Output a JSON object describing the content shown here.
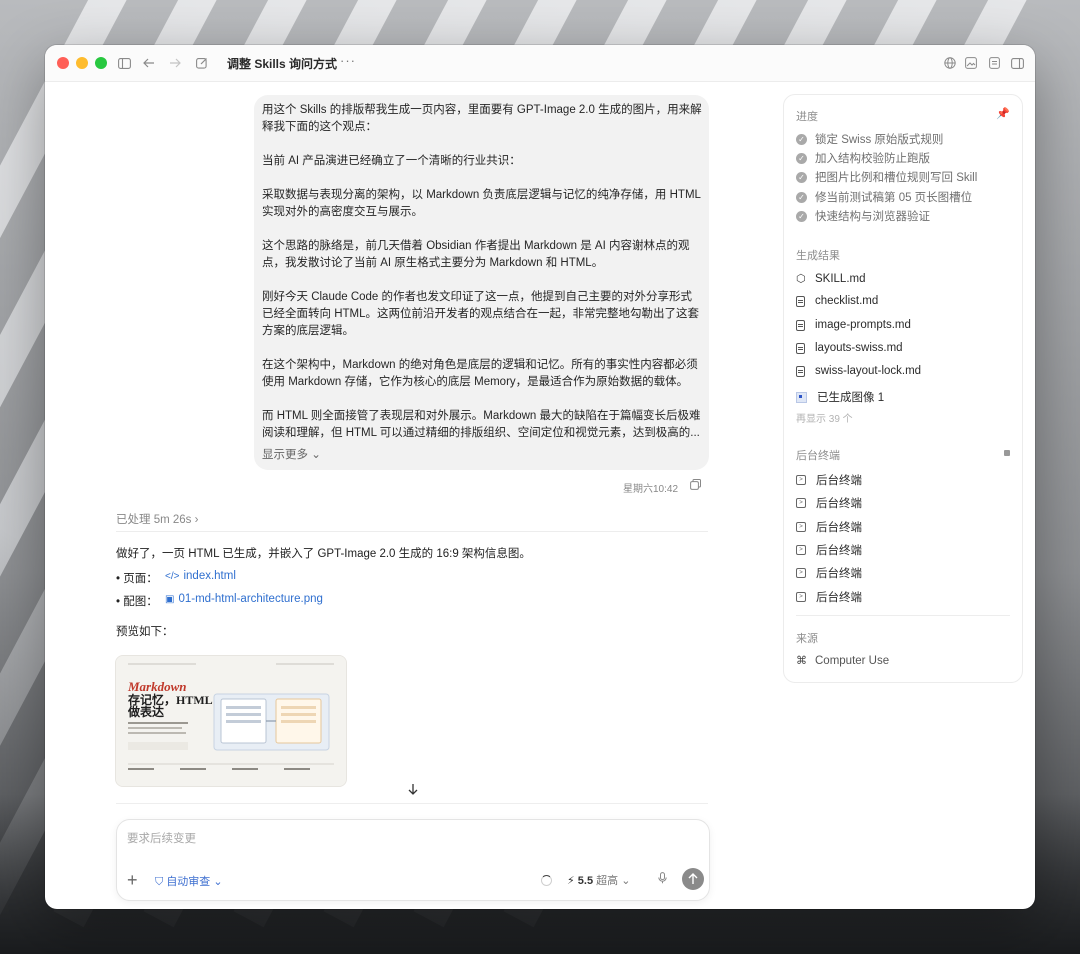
{
  "window": {
    "title": "调整 Skills 询问方式",
    "more": "···"
  },
  "user_message": {
    "paragraphs": [
      "用这个 Skills 的排版帮我生成一页内容，里面要有 GPT-Image 2.0 生成的图片，用来解释我下面的这个观点：",
      "当前 AI 产品演进已经确立了一个清晰的行业共识：",
      "采取数据与表现分离的架构，以 Markdown 负责底层逻辑与记忆的纯净存储，用 HTML 实现对外的高密度交互与展示。",
      "这个思路的脉络是，前几天借着 Obsidian 作者提出 Markdown 是 AI 内容谢林点的观点，我发散讨论了当前 AI 原生格式主要分为 Markdown 和 HTML。",
      "刚好今天 Claude Code 的作者也发文印证了这一点，他提到自己主要的对外分享形式已经全面转向 HTML。这两位前沿开发者的观点结合在一起，非常完整地勾勒出了这套方案的底层逻辑。",
      "在这个架构中，Markdown 的绝对角色是底层的逻辑和记忆。所有的事实性内容都必须使用 Markdown 存储，它作为核心的底层 Memory，是最适合作为原始数据的载体。",
      "而 HTML 则全面接管了表现层和对外展示。Markdown 最大的缺陷在于篇幅变长后极难阅读和理解，但 HTML 可以通过精细的排版组织、空间定位和视觉元素，达到极高的..."
    ],
    "show_more": "显示更多 ⌄",
    "timestamp": "星期六10:42"
  },
  "assistant": {
    "processed": "已处理 5m 26s ›",
    "summary": "做好了，一页 HTML 已生成，并嵌入了 GPT-Image 2.0 生成的 16:9 架构信息图。",
    "page_label": "• 页面：",
    "page_link": "index.html",
    "image_label": "• 配图：",
    "image_link": "01-md-html-architecture.png",
    "preview_label": "预览如下：",
    "preview": {
      "heading_en": "Markdown",
      "heading_zh_1": "存记忆，HTML",
      "heading_zh_2": "做表达"
    }
  },
  "composer": {
    "placeholder": "要求后续变更",
    "review": "自动审查 ⌄",
    "model_speed": "5.5",
    "model_quality": "超高 ⌄"
  },
  "panel": {
    "progress_title": "进度",
    "progress": [
      "锁定 Swiss 原始版式规则",
      "加入结构校验防止跑版",
      "把图片比例和槽位规则写回 Skill",
      "修当前测试稿第 05 页长图槽位",
      "快速结构与浏览器验证"
    ],
    "results_title": "生成结果",
    "results": [
      "SKILL.md",
      "checklist.md",
      "image-prompts.md",
      "layouts-swiss.md",
      "swiss-layout-lock.md"
    ],
    "generated_image": "已生成图像 1",
    "more_hint": "再显示 39 个",
    "terminals_title": "后台终端",
    "terminals": [
      "后台终端",
      "后台终端",
      "后台终端",
      "后台终端",
      "后台终端",
      "后台终端"
    ],
    "source_title": "来源",
    "source": "Computer Use"
  },
  "colors": {
    "link": "#2f6fcf",
    "accent_red": "#c0392b",
    "traffic_red": "#ff5f57",
    "traffic_yellow": "#febc2e",
    "traffic_green": "#28c840"
  }
}
